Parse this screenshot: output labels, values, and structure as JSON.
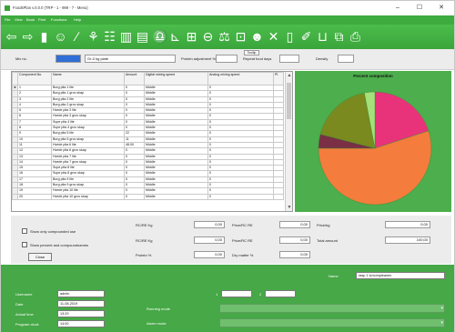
{
  "window": {
    "title": "FoodsPlan v.0.0.0 (TRP - 1 - 999 - 7 - Menu)",
    "minimize": "–",
    "maximize": "☐",
    "close": "✕"
  },
  "menu": [
    "File",
    "View",
    "Book",
    "Print",
    "Functions",
    "Help"
  ],
  "toolbar_icons": [
    "arrow-left-icon",
    "arrow-right-icon",
    "save-icon",
    "person-icon",
    "pen-icon",
    "recipe-icon",
    "list-icon",
    "book-icon",
    "pages-icon",
    "scale-icon",
    "chart-icon",
    "grid-icon",
    "clock-icon",
    "balance-icon",
    "search-page-icon",
    "people-icon",
    "cut-icon",
    "document-icon",
    "stamp-icon",
    "cart-icon",
    "export-icon",
    "print-icon"
  ],
  "filters": {
    "mix_label": "Mix no.",
    "mix_value": "",
    "name_value": "Gr-0 kg plate",
    "protein_label": "Protein adjustment %",
    "days_label": "Repeat food days",
    "density_label": "Density",
    "tooltip": "Tooltip"
  },
  "grid": {
    "headers": [
      "Component No.",
      "Name",
      "Amount",
      "Digital mixing speed",
      "Analog mixing speed",
      "Pl."
    ],
    "rows": [
      [
        "1",
        "Burg pita 1 lite",
        "0",
        "Middle",
        "0"
      ],
      [
        "2",
        "Burg pita 1 grov skap",
        "0",
        "Middle",
        "0"
      ],
      [
        "3",
        "Burg pita 2 lite",
        "0",
        "Middle",
        "0"
      ],
      [
        "4",
        "Burg pita 2 grov skap",
        "0",
        "Middle",
        "0"
      ],
      [
        "5",
        "Hvede pita 3 lite",
        "0",
        "Middle",
        "0"
      ],
      [
        "6",
        "Hvede pita 3 grov skap",
        "0",
        "Middle",
        "0"
      ],
      [
        "7",
        "Supe pita 4 lite",
        "0",
        "Middle",
        "0"
      ],
      [
        "8",
        "Supe pita 4 grov skap",
        "0",
        "Middle",
        "0"
      ],
      [
        "9",
        "Burg pita 5 lite",
        "22",
        "Middle",
        "0"
      ],
      [
        "10",
        "Burg pita 5 grov skap",
        "11",
        "Middle",
        "0"
      ],
      [
        "11",
        "Hvede pita 6 lite",
        "48.00",
        "Middle",
        "0"
      ],
      [
        "12",
        "Hvede pita 6 grov skap",
        "0",
        "Middle",
        "0"
      ],
      [
        "13",
        "Hvede pita 7 lite",
        "0",
        "Middle",
        "0"
      ],
      [
        "14",
        "Hvede pita 7 grov skap",
        "0",
        "Middle",
        "0"
      ],
      [
        "15",
        "Supe pita 8 lite",
        "0",
        "Middle",
        "0"
      ],
      [
        "16",
        "Supe pita 8 grov skap",
        "0",
        "Middle",
        "0"
      ],
      [
        "17",
        "Burg pita 9 lite",
        "0",
        "Middle",
        "0"
      ],
      [
        "18",
        "Burg pita 9 grov skap",
        "0",
        "Middle",
        "0"
      ],
      [
        "19",
        "Hvede pita 10 lite",
        "0",
        "Middle",
        "0"
      ],
      [
        "20",
        "Hvede pita 10 grov skap",
        "0",
        "Middle",
        "0"
      ]
    ]
  },
  "chart_data": {
    "type": "pie",
    "title": "Percent composition",
    "slices": [
      {
        "value": 20,
        "color": "#e8337a"
      },
      {
        "value": 55,
        "color": "#f47c3c"
      },
      {
        "value": 4,
        "color": "#7a2f44"
      },
      {
        "value": 18,
        "color": "#7a8a1e"
      },
      {
        "value": 3,
        "color": "#a6e07a"
      }
    ],
    "legend": "none"
  },
  "options": {
    "show_comp_use": "Show only compounded use",
    "show_percent": "Show percent and compoundnames",
    "close_button": "Close",
    "m1_label": "RC/RE Kg",
    "m1_value": "0,00",
    "m2_label": "RC/RE Kg",
    "m2_value": "0,00",
    "m3_label": "Protein %",
    "m3_value": "0,00",
    "p1_label": "Price/RC RE",
    "p1_value": "0,00",
    "p2_label": "Price/RC RE",
    "p2_value": "0,00",
    "p3_label": "Dry matter %",
    "p3_value": "0,00",
    "r1_label": "Price/kg",
    "r1_value": "0,00",
    "r2_label": "Total amount",
    "r2_value": "100,00"
  },
  "bottom": {
    "name_label": "Name",
    "name_value": "rasp 1 tv/compleanen",
    "username_label": "Username",
    "username_value": "admin",
    "date_label": "Date",
    "date_value": "11-08-2019",
    "time_label": "Actual time",
    "time_value": "13:29",
    "program_label": "Program clock",
    "program_value": "14:00",
    "running_label": "Running mode",
    "alarm_label": "Alarm mode",
    "field1_label": "1",
    "field2_label": "2"
  }
}
